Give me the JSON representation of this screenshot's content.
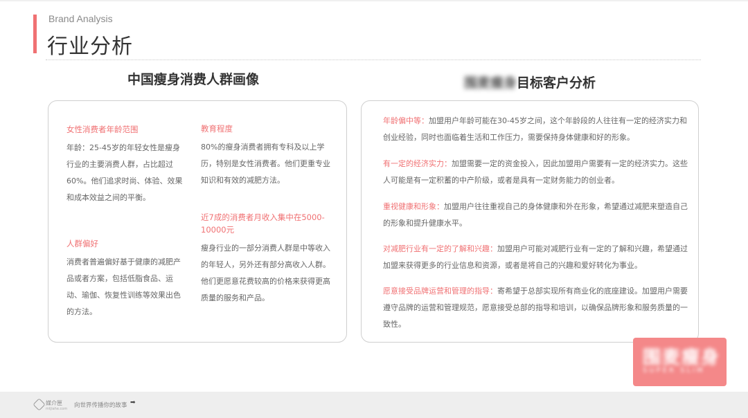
{
  "header": {
    "brand_en": "Brand Analysis",
    "title": "行业分析"
  },
  "left": {
    "title": "中国瘦身消费人群画像",
    "blocks": [
      {
        "heading": "女性消费者年龄范围",
        "text": "年龄：25-45岁的年轻女性是瘦身行业的主要消费人群，占比超过60%。他们追求时尚、体验、效果和成本效益之间的平衡。"
      },
      {
        "heading": "教育程度",
        "text": "80%的瘦身消费者拥有专科及以上学历，特别是女性消费者。他们更重专业知识和有效的减肥方法。"
      },
      {
        "heading": "人群偏好",
        "text": "消费者普遍偏好基于健康的减肥产品或者方案，包括低脂食品、运动、瑜伽、恢复性训练等效果出色的方法。"
      },
      {
        "heading": "近7成的消费者月收入集中在5000-10000元",
        "text": "瘦身行业的一部分消费人群是中等收入的年轻人，另外还有部分高收入人群。他们更愿意花费较高的价格来获得更高质量的服务和产品。"
      }
    ]
  },
  "right": {
    "title_blurred": "围麦瘦身",
    "title": "目标客户分析",
    "items": [
      {
        "key": "年龄偏中等：",
        "text": "加盟用户年龄可能在30-45岁之间，这个年龄段的人往往有一定的经济实力和创业经验，同时也面临着生活和工作压力，需要保持身体健康和好的形象。"
      },
      {
        "key": "有一定的经济实力：",
        "text": "加盟需要一定的资金投入，因此加盟用户需要有一定的经济实力。这些人可能是有一定积蓄的中产阶级，或者是具有一定财务能力的创业者。"
      },
      {
        "key": "重视健康和形象：",
        "text": "加盟用户往往重视自己的身体健康和外在形象，希望通过减肥来塑造自己的形象和提升健康水平。"
      },
      {
        "key": "对减肥行业有一定的了解和兴趣：",
        "text": "加盟用户可能对减肥行业有一定的了解和兴趣，希望通过加盟来获得更多的行业信息和资源，或者是将自己的兴趣和爱好转化为事业。"
      },
      {
        "key": "愿意接受品牌运营和管理的指导：",
        "text": "寄希望于总部实现所有商业化的底座建设。加盟用户需要遵守品牌的运营和管理规范，愿意接受总部的指导和培训，以确保品牌形象和服务质量的一致性。"
      }
    ]
  },
  "badge": {
    "text": "围麦瘦身",
    "sub": "SUPER SLIM"
  },
  "footer": {
    "logo_name": "媒介匣",
    "logo_url": "mtjiahe.com",
    "slogan": "向世界传播你的故事",
    "arrow": "➡"
  },
  "colors": {
    "accent": "#f07173",
    "badge": "#f48889",
    "footer_bg": "#eeeeee"
  }
}
